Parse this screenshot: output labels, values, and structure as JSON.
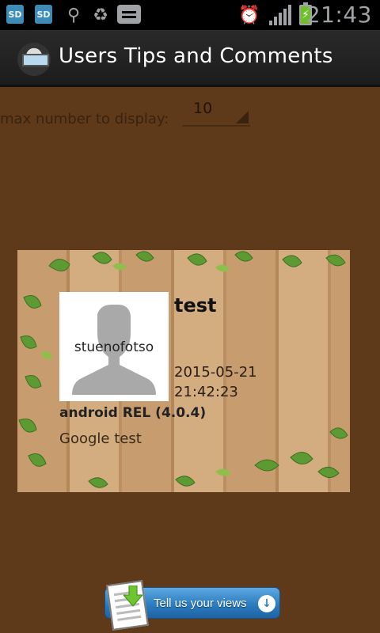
{
  "status_bar": {
    "time": "21:43",
    "icons": [
      "sd-card-icon",
      "sd-card-icon",
      "usb-icon",
      "recycle-icon",
      "chat-icon",
      "alarm-icon",
      "signal-icon",
      "battery-charging-icon"
    ],
    "sd_label": "SD"
  },
  "action_bar": {
    "title": "Users Tips and Comments"
  },
  "filter": {
    "label": "max number to display:",
    "value": "10"
  },
  "comment": {
    "avatar_caption": "stuenofotso",
    "title": "test",
    "date": "2015-05-21",
    "time": "21:42:23",
    "device": "android REL (4.0.4)",
    "body": "Google test"
  },
  "feedback": {
    "label": "Tell us your views"
  },
  "colors": {
    "background": "#5e3a1a",
    "action_bar": "#1e1e1e",
    "button_blue": "#2c7cc0"
  }
}
